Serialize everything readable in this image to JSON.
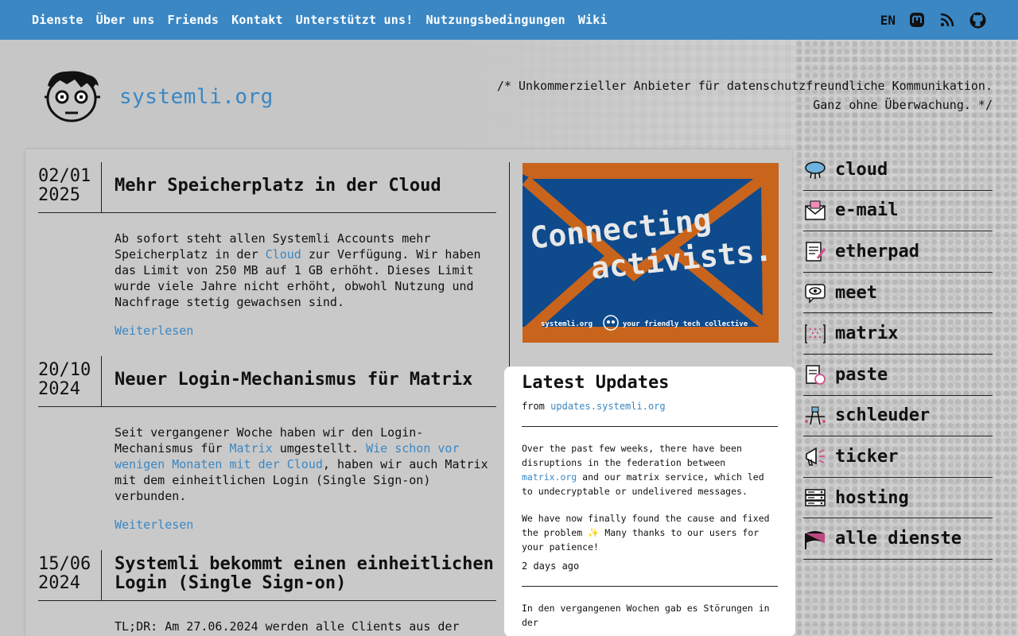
{
  "nav": {
    "links": [
      "Dienste",
      "Über uns",
      "Friends",
      "Kontakt",
      "Unterstützt uns!",
      "Nutzungsbedingungen",
      "Wiki"
    ],
    "lang": "EN",
    "icons": [
      "mastodon-icon",
      "rss-icon",
      "github-icon"
    ]
  },
  "header": {
    "site_name": "systemli.org",
    "tagline_line1": "/* Unkommerzieller Anbieter für datenschutzfreundliche Kommunikation.",
    "tagline_line2": "Ganz ohne Überwachung. */"
  },
  "articles": [
    {
      "date_line1": "02/01",
      "date_line2": "2025",
      "title": "Mehr Speicherplatz in der Cloud",
      "body_pre": "Ab sofort steht allen Systemli Accounts mehr Speicherplatz in der ",
      "body_link": "Cloud",
      "body_post": " zur Verfügung. Wir haben das Limit von 250 MB auf 1 GB erhöht. Dieses Limit wurde viele Jahre nicht erhöht, obwohl Nutzung und Nachfrage stetig gewachsen sind.",
      "more": "Weiterlesen"
    },
    {
      "date_line1": "20/10",
      "date_line2": "2024",
      "title": "Neuer Login-Mechanismus für Matrix",
      "body_pre": "Seit vergangener Woche haben wir den Login-Mechanismus für ",
      "body_link": "Matrix",
      "body_mid": " umgestellt. ",
      "body_link2": "Wie schon vor wenigen Monaten mit der Cloud",
      "body_post": ", haben wir auch Matrix mit dem einheitlichen Login (Single Sign-on) verbunden.",
      "more": "Weiterlesen"
    },
    {
      "date_line1": "15/06",
      "date_line2": "2024",
      "title": "Systemli bekommt einen einheitlichen Login (Single Sign-on)",
      "body_pre": "TL;DR: Am 27.06.2024 werden alle Clients aus der"
    }
  ],
  "banner": {
    "line1": "Connecting",
    "line2": "activists.",
    "footer_left": "systemli.org",
    "footer_right": "your friendly tech collective",
    "colors": {
      "bg": "#0e4a8c",
      "accent": "#c8641c"
    }
  },
  "updates": {
    "title": "Latest Updates",
    "from_label": "from",
    "from_link": "updates.systemli.org",
    "post1_pre": "Over the past few weeks, there have been disruptions in the federation between ",
    "post1_link": "matrix.org",
    "post1_post": " and our matrix service, which led to undecryptable or undelivered messages.",
    "post1_p2": "We have now finally found the cause and fixed the problem ✨ Many thanks to our users for your patience!",
    "post1_ago": "2 days ago",
    "post2_pre": "In den vergangenen Wochen gab es Störungen in der"
  },
  "services": [
    {
      "label": "cloud",
      "icon": "cloud-icon"
    },
    {
      "label": "e-mail",
      "icon": "envelope-icon"
    },
    {
      "label": "etherpad",
      "icon": "pad-icon"
    },
    {
      "label": "meet",
      "icon": "eye-icon"
    },
    {
      "label": "matrix",
      "icon": "matrix-icon"
    },
    {
      "label": "paste",
      "icon": "paste-icon"
    },
    {
      "label": "schleuder",
      "icon": "schleuder-icon"
    },
    {
      "label": "ticker",
      "icon": "megaphone-icon"
    },
    {
      "label": "hosting",
      "icon": "server-icon"
    },
    {
      "label": "alle dienste",
      "icon": "flag-icon"
    }
  ],
  "colors": {
    "nav": "#3a87c4",
    "link": "#3a87c4",
    "page_bg": "#c6c6c6"
  }
}
